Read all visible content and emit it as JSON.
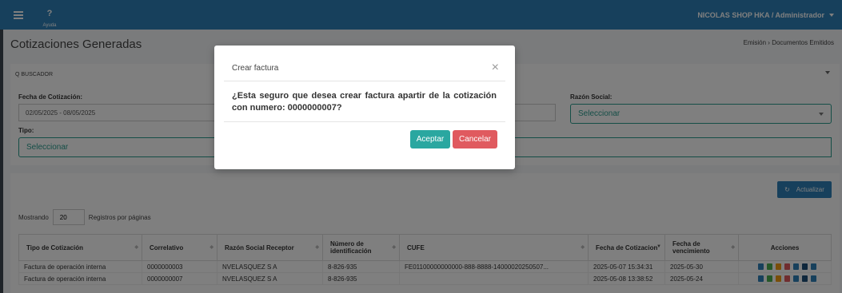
{
  "topbar": {
    "help_icon": "?",
    "help_label": "Ayuda",
    "user": "NICOLAS SHOP HKA / Administrador"
  },
  "page": {
    "title": "Cotizaciones Generadas",
    "breadcrumb_1": "Emisión",
    "breadcrumb_2": "Documentos Emitidos"
  },
  "filters": {
    "search_label": "Q BUSCADOR",
    "date_label": "Fecha de Cotización:",
    "date_value": "02/05/2025 - 08/05/2025",
    "razon_label": "Razón Social:",
    "razon_value": "Seleccionar",
    "tipo_label": "Tipo:",
    "tipo_value": "Seleccionar"
  },
  "toolbar": {
    "refresh_label": "Actualizar",
    "refresh_icon": "↻"
  },
  "pagination": {
    "showing": "Mostrando",
    "page_size": "20",
    "suffix": "Registros por páginas"
  },
  "table": {
    "headers": [
      "Tipo de Cotización",
      "Correlativo",
      "Razón Social Receptor",
      "Número de identificación",
      "CUFE",
      "Fecha de Cotizacion",
      "Fecha de vencimiento",
      "Acciones"
    ],
    "rows": [
      [
        "Factura de operación interna",
        "0000000003",
        "NVELASQUEZ S A",
        "8-826-935",
        "FE01100000000000-888-8888-14000020250507...",
        "2025-05-07 15:34:31",
        "2025-05-30",
        ""
      ],
      [
        "Factura de operación interna",
        "0000000007",
        "NVELASQUEZ S A",
        "8-826-935",
        "",
        "2025-05-08 13:38:52",
        "2025-05-24",
        ""
      ]
    ]
  },
  "modal": {
    "title": "Crear factura",
    "close_icon": "×",
    "message": "¿Esta seguro que desea crear factura apartir de la cotización con numero: 0000000007?",
    "accept": "Aceptar",
    "cancel": "Cancelar"
  },
  "colors": {
    "topbar": "#2f81b8",
    "accent": "#2a9d8f",
    "cancel": "#e05a5f"
  }
}
